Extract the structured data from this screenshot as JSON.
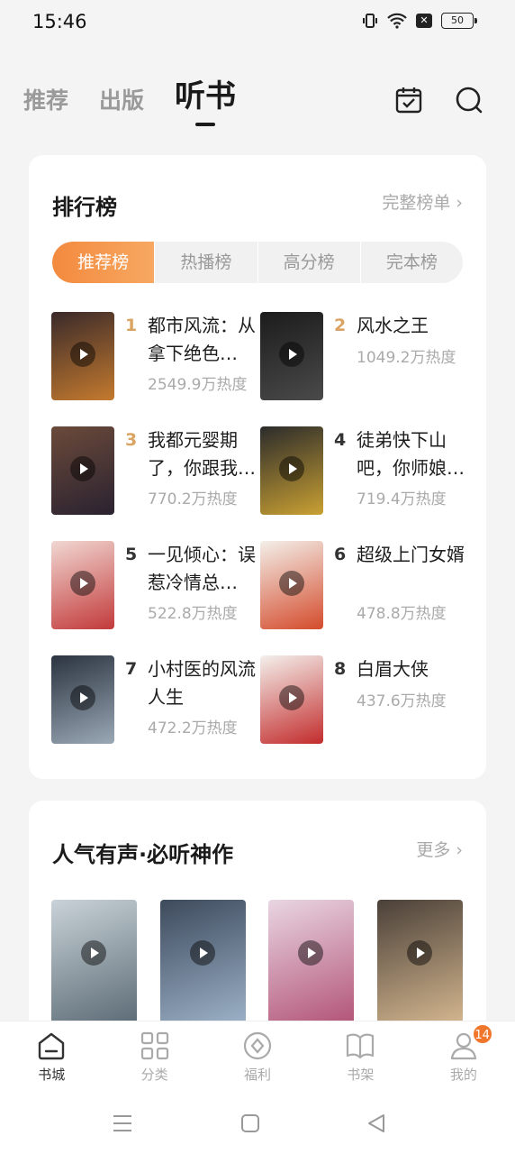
{
  "status": {
    "time": "15:46",
    "battery": "50"
  },
  "top_tabs": [
    {
      "label": "推荐",
      "active": false
    },
    {
      "label": "出版",
      "active": false
    },
    {
      "label": "听书",
      "active": true
    }
  ],
  "ranking": {
    "title": "排行榜",
    "more": "完整榜单",
    "segments": [
      "推荐榜",
      "热播榜",
      "高分榜",
      "完本榜"
    ],
    "items": [
      {
        "rank": "1",
        "title": "都市风流：从拿下绝色…",
        "heat": "2549.9万热度",
        "cover_colors": [
          "#3a2a2a",
          "#c47a2e"
        ]
      },
      {
        "rank": "2",
        "title": "风水之王",
        "heat": "1049.2万热度",
        "cover_colors": [
          "#1c1c1c",
          "#4a4a4a"
        ]
      },
      {
        "rank": "3",
        "title": "我都元婴期了，你跟我…",
        "heat": "770.2万热度",
        "cover_colors": [
          "#6b4a3a",
          "#2a2230"
        ]
      },
      {
        "rank": "4",
        "title": "徒弟快下山吧，你师娘…",
        "heat": "719.4万热度",
        "cover_colors": [
          "#2b2b2b",
          "#c9a032"
        ]
      },
      {
        "rank": "5",
        "title": "一见倾心：误惹冷情总…",
        "heat": "522.8万热度",
        "cover_colors": [
          "#f1d7d2",
          "#c23a3a"
        ]
      },
      {
        "rank": "6",
        "title": "超级上门女婿",
        "heat": "478.8万热度",
        "cover_colors": [
          "#f3efe9",
          "#d44b2c"
        ]
      },
      {
        "rank": "7",
        "title": "小村医的风流人生",
        "heat": "472.2万热度",
        "cover_colors": [
          "#2b3340",
          "#9aa8b6"
        ]
      },
      {
        "rank": "8",
        "title": "白眉大侠",
        "heat": "437.6万热度",
        "cover_colors": [
          "#f4f0ec",
          "#c22c2c"
        ]
      }
    ]
  },
  "hot": {
    "title": "人气有声·必听神作",
    "more": "更多",
    "covers": [
      {
        "cover_colors": [
          "#c9d2d8",
          "#5a6a74"
        ]
      },
      {
        "cover_colors": [
          "#3d4a5c",
          "#9db2c9"
        ]
      },
      {
        "cover_colors": [
          "#e9d6e3",
          "#b25276"
        ]
      },
      {
        "cover_colors": [
          "#4a4038",
          "#d6b890"
        ]
      }
    ]
  },
  "bottom_nav": [
    {
      "label": "书城",
      "icon": "store-icon",
      "active": true
    },
    {
      "label": "分类",
      "icon": "grid-icon",
      "active": false
    },
    {
      "label": "福利",
      "icon": "gift-icon",
      "active": false
    },
    {
      "label": "书架",
      "icon": "book-icon",
      "active": false
    },
    {
      "label": "我的",
      "icon": "user-icon",
      "active": false,
      "badge": "14"
    }
  ]
}
